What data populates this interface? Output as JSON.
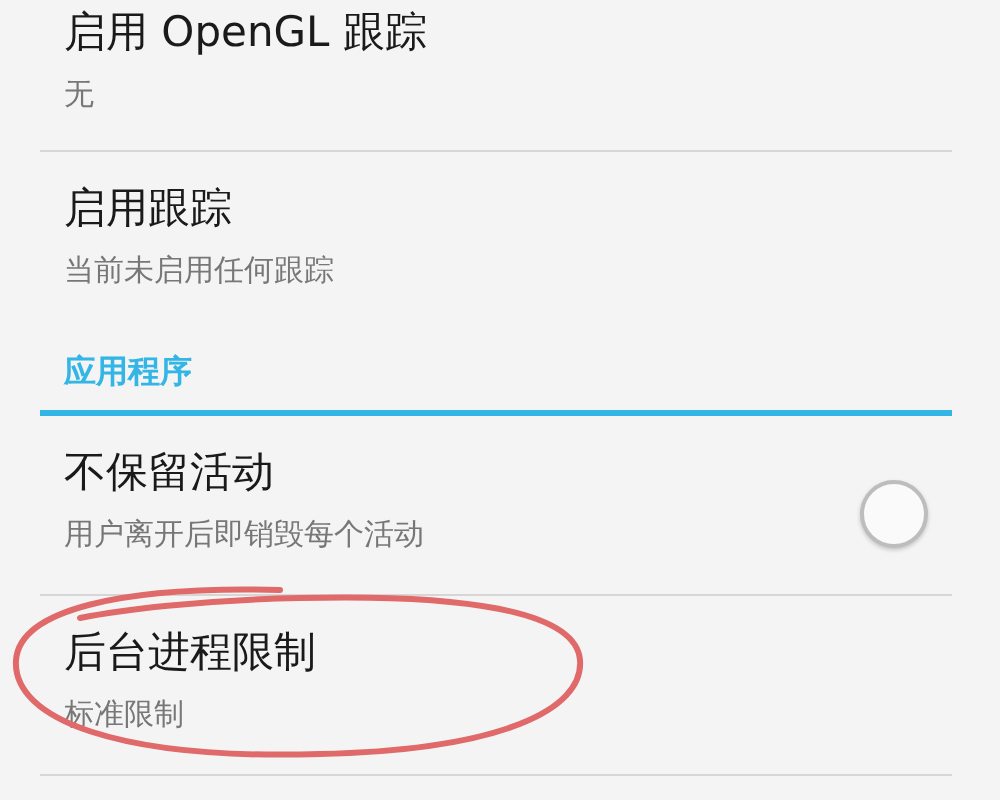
{
  "items": [
    {
      "kind": "setting",
      "title": "启用 OpenGL 跟踪",
      "summary": "无"
    },
    {
      "kind": "setting",
      "title": "启用跟踪",
      "summary": "当前未启用任何跟踪"
    },
    {
      "kind": "category",
      "title": "应用程序"
    },
    {
      "kind": "toggle",
      "title": "不保留活动",
      "summary": "用户离开后即销毁每个活动",
      "checked": false
    },
    {
      "kind": "setting",
      "title": "后台进程限制",
      "summary": "标准限制",
      "circled": true
    }
  ]
}
